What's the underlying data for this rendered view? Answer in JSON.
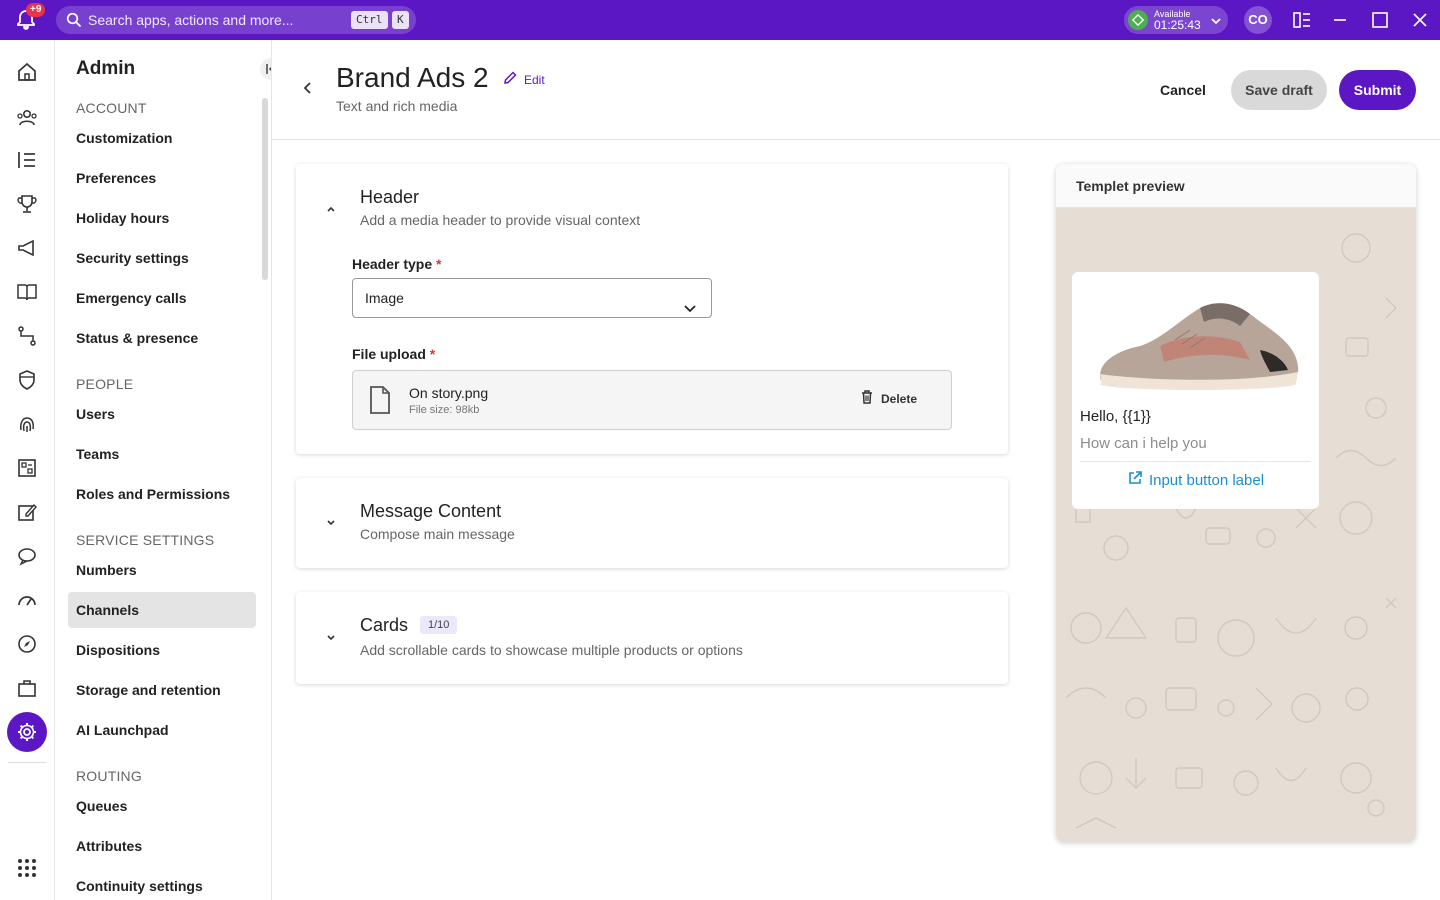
{
  "topbar": {
    "notif_count": "+9",
    "search_placeholder": "Search apps, actions and more...",
    "kbd_ctrl": "Ctrl",
    "kbd_k": "K",
    "status_label": "Available",
    "status_time": "01:25:43",
    "avatar_initials": "CO"
  },
  "nav": {
    "title": "Admin",
    "sections": {
      "account": "ACCOUNT",
      "people": "PEOPLE",
      "service": "SERVICE SETTINGS",
      "routing": "ROUTING"
    },
    "items": {
      "customization": "Customization",
      "preferences": "Preferences",
      "holiday_hours": "Holiday hours",
      "security_settings": "Security settings",
      "emergency_calls": "Emergency calls",
      "status_presence": "Status & presence",
      "users": "Users",
      "teams": "Teams",
      "roles": "Roles and Permissions",
      "numbers": "Numbers",
      "channels": "Channels",
      "dispositions": "Dispositions",
      "storage": "Storage and retention",
      "ai_launchpad": "AI Launchpad",
      "queues": "Queues",
      "attributes": "Attributes",
      "continuity": "Continuity settings"
    },
    "active": "Channels"
  },
  "page": {
    "title": "Brand Ads 2",
    "edit_label": "Edit",
    "subtitle": "Text and rich media",
    "cancel_label": "Cancel",
    "save_draft_label": "Save draft",
    "submit_label": "Submit"
  },
  "header_section": {
    "title": "Header",
    "subtitle": "Add a media header to provide visual context",
    "header_type_label": "Header type",
    "header_type_value": "Image",
    "file_upload_label": "File upload",
    "required_mark": "*",
    "file_name": "On story.png",
    "file_size": "File size: 98kb",
    "delete_label": "Delete"
  },
  "message_section": {
    "title": "Message Content",
    "subtitle": "Compose main message"
  },
  "cards_section": {
    "title": "Cards",
    "count": "1/10",
    "subtitle": "Add scrollable cards to showcase multiple products or options"
  },
  "preview": {
    "title": "Templet preview",
    "greeting": "Hello, {{1}}",
    "body": "How can i help you",
    "button_label": "Input button label"
  },
  "colors": {
    "brand": "#5b17c4",
    "link": "#1a8fd0",
    "required": "#d43a3a",
    "chat_bg": "#e6ddd4"
  }
}
